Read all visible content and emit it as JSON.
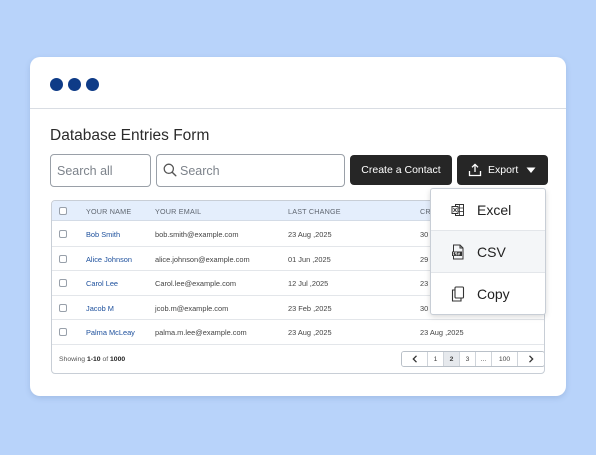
{
  "form": {
    "title": "Database Entries Form",
    "search_all_placeholder": "Search all",
    "search_placeholder": "Search",
    "create_label": "Create a Contact",
    "export_label": "Export"
  },
  "table": {
    "headers": [
      "YOUR NAME",
      "YOUR EMAIL",
      "LAST CHANGE",
      "CR"
    ],
    "rows": [
      {
        "name": "Bob Smith",
        "email": "bob.smith@example.com",
        "last_change": "23 Aug ,2025",
        "created": "30"
      },
      {
        "name": "Alice Johnson",
        "email": "alice.johnson@example.com",
        "last_change": "01 Jun ,2025",
        "created": "29"
      },
      {
        "name": "Carol Lee",
        "email": "Carol.lee@example.com",
        "last_change": "12 Jul ,2025",
        "created": "23"
      },
      {
        "name": "Jacob M",
        "email": "jcob.m@example.com",
        "last_change": "23 Feb ,2025",
        "created": "30"
      },
      {
        "name": "Palma McLeay",
        "email": "palma.m.lee@example.com",
        "last_change": "23 Aug ,2025",
        "created": "23 Aug ,2025"
      }
    ]
  },
  "footer": {
    "showing_prefix": "Showing",
    "range": "1-10",
    "of": "of",
    "total": "1000",
    "pages": [
      "1",
      "2",
      "3",
      "...",
      "100"
    ],
    "active_page": "2"
  },
  "export_menu": {
    "items": [
      {
        "label": "Excel",
        "icon": "excel-icon"
      },
      {
        "label": "CSV",
        "icon": "csv-file-icon"
      },
      {
        "label": "Copy",
        "icon": "copy-icon"
      }
    ]
  },
  "colors": {
    "background": "#b8d3fa",
    "window_dots": "#0e3b87",
    "button_dark": "#262626",
    "table_header_bg": "#e4eefc",
    "name_link": "#1c4f9c"
  }
}
